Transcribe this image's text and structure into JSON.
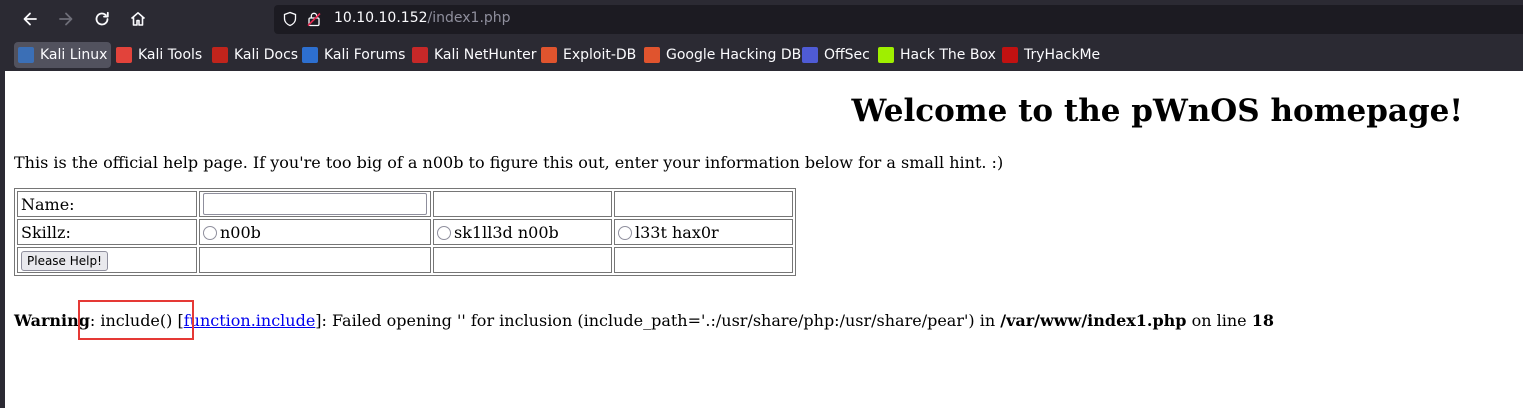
{
  "browser": {
    "url_host": "10.10.10.152",
    "url_path": "/index1.php",
    "nav": {
      "back_icon": "arrow-left-icon",
      "forward_icon": "arrow-right-icon",
      "reload_icon": "reload-icon",
      "home_icon": "home-icon"
    },
    "bookmarks": [
      {
        "label": "Kali Linux",
        "color": "#3b6fb6",
        "active": true
      },
      {
        "label": "Kali Tools",
        "color": "#e2433b"
      },
      {
        "label": "Kali Docs",
        "color": "#c0241c"
      },
      {
        "label": "Kali Forums",
        "color": "#2d6fd0"
      },
      {
        "label": "Kali NetHunter",
        "color": "#c62828"
      },
      {
        "label": "Exploit-DB",
        "color": "#e0542e"
      },
      {
        "label": "Google Hacking DB",
        "color": "#e0542e"
      },
      {
        "label": "OffSec",
        "color": "#4f5bd5"
      },
      {
        "label": "Hack The Box",
        "color": "#9fef00"
      },
      {
        "label": "TryHackMe",
        "color": "#c11111"
      }
    ]
  },
  "page": {
    "title": "Welcome to the pWnOS homepage!",
    "intro": "This is the official help page. If you're too big of a n00b to figure this out, enter your information below for a small hint. :)",
    "form": {
      "name_label": "Name:",
      "name_value": "",
      "skill_label": "Skillz:",
      "skills": [
        "n00b",
        "sk1ll3d n00b",
        "l33t hax0r"
      ],
      "submit_label": "Please Help!"
    },
    "warning": {
      "label": "Warning",
      "text1": ": include() [",
      "link": "function.include",
      "text2": "]: Failed opening '' for inclusion (include_path='.:/usr/share/php:/usr/share/pear') in ",
      "file": "/var/www/index1.php",
      "text3": " on line ",
      "line": "18"
    },
    "highlight_color": "#e53935"
  }
}
